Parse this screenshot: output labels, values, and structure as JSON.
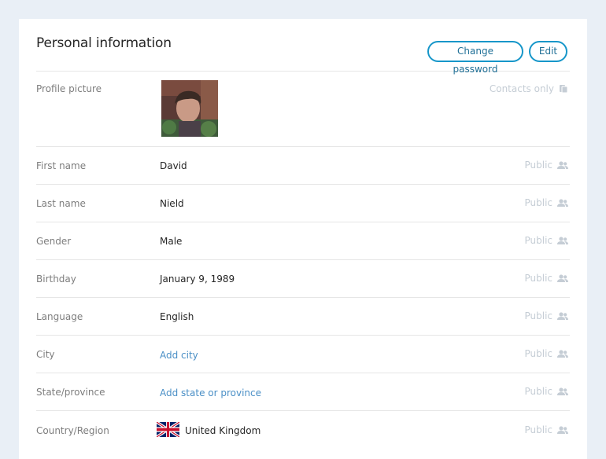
{
  "header": {
    "title": "Personal information",
    "change_password_label": "Change password",
    "edit_label": "Edit"
  },
  "rows": {
    "profile_picture": {
      "label": "Profile picture",
      "privacy": "Contacts only"
    },
    "first_name": {
      "label": "First name",
      "value": "David",
      "privacy": "Public"
    },
    "last_name": {
      "label": "Last name",
      "value": "Nield",
      "privacy": "Public"
    },
    "gender": {
      "label": "Gender",
      "value": "Male",
      "privacy": "Public"
    },
    "birthday": {
      "label": "Birthday",
      "value": "January 9, 1989",
      "privacy": "Public"
    },
    "language": {
      "label": "Language",
      "value": "English",
      "privacy": "Public"
    },
    "city": {
      "label": "City",
      "link": "Add city",
      "privacy": "Public"
    },
    "state": {
      "label": "State/province",
      "link": "Add state or province",
      "privacy": "Public"
    },
    "country": {
      "label": "Country/Region",
      "value": "United Kingdom",
      "privacy": "Public"
    }
  },
  "colors": {
    "accent": "#1696c9",
    "link": "#4a8fc6",
    "privacy_muted": "#c5cdd5",
    "background": "#e9eff6"
  },
  "icons": {
    "contacts_only": "contact-card-icon",
    "public": "people-icon",
    "country_flag": "uk-flag-icon"
  }
}
